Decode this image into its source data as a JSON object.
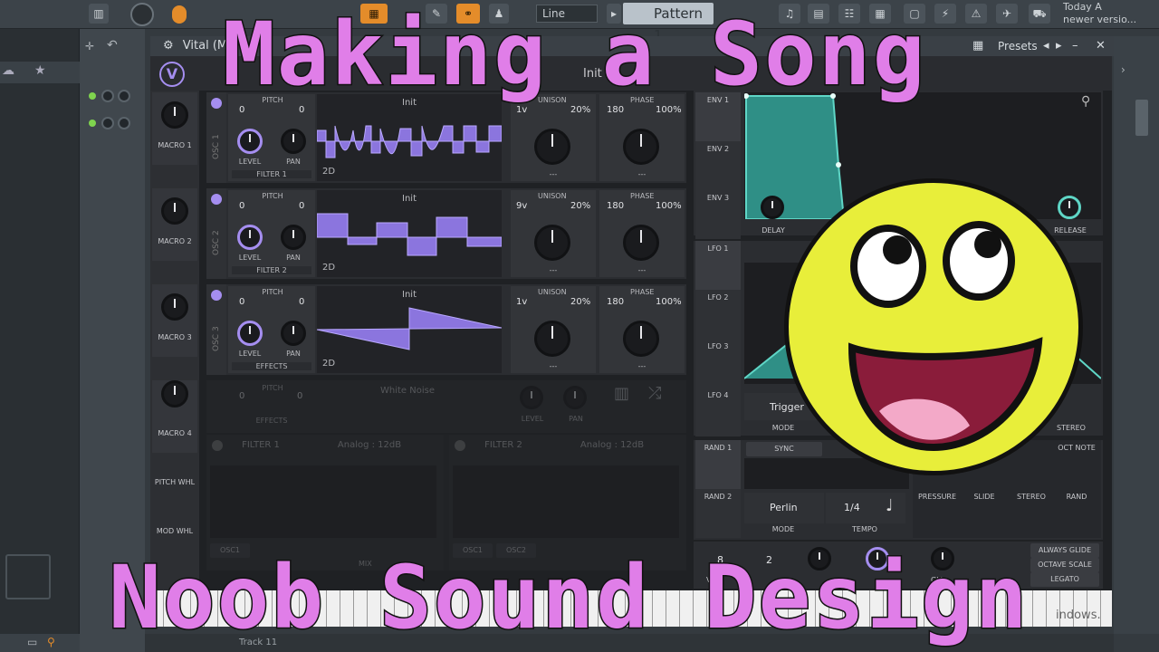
{
  "overlay": {
    "title_top": "Making a Song",
    "title_bottom": "Noob Sound Design"
  },
  "toolbar": {
    "line_select": "Line",
    "pattern_name": "Pattern 1",
    "hint_line1": "Today  A",
    "hint_line2": "newer versio..."
  },
  "vital": {
    "window_title": "Vital (M",
    "preset_name": "Init P",
    "presets_label": "Presets",
    "macros": [
      "MACRO 1",
      "MACRO 2",
      "MACRO 3",
      "MACRO 4"
    ],
    "pitch_wheel": "PITCH WHL",
    "mod_wheel": "MOD WHL",
    "oscillators": [
      {
        "name": "OSC 1",
        "wave": "Init",
        "pitch_l": "0",
        "pitch_r": "0",
        "voices": "1v",
        "unison_pct": "20%",
        "phase": "180",
        "phase_pct": "100%",
        "route": "FILTER 1"
      },
      {
        "name": "OSC 2",
        "wave": "Init",
        "pitch_l": "0",
        "pitch_r": "0",
        "voices": "9v",
        "unison_pct": "20%",
        "phase": "180",
        "phase_pct": "100%",
        "route": "FILTER 2"
      },
      {
        "name": "OSC 3",
        "wave": "Init",
        "pitch_l": "0",
        "pitch_r": "0",
        "voices": "1v",
        "unison_pct": "20%",
        "phase": "180",
        "phase_pct": "100%",
        "route": "EFFECTS"
      }
    ],
    "labels": {
      "pitch": "PITCH",
      "level": "LEVEL",
      "pan": "PAN",
      "unison": "UNISON",
      "phase": "PHASE",
      "two_d": "2D",
      "dashes": "---"
    },
    "sample": {
      "name": "White Noise",
      "pitch_l": "0",
      "pitch_r": "0",
      "route": "EFFECTS",
      "level": "LEVEL",
      "pan": "PAN"
    },
    "filters": [
      {
        "name": "FILTER 1",
        "type": "Analog : 12dB"
      },
      {
        "name": "FILTER 2",
        "type": "Analog : 12dB"
      }
    ],
    "filter_osc_chips": [
      "OSC1",
      "OSC2"
    ],
    "filter_mix": "MIX",
    "envelopes": [
      "ENV 1",
      "ENV 2",
      "ENV 3"
    ],
    "env_knobs": {
      "delay": "DELAY",
      "release": "RELEASE"
    },
    "lfos": [
      "LFO 1",
      "LFO 2",
      "LFO 3",
      "LFO 4"
    ],
    "lfo_mode_value": "Trigger",
    "lfo_mode": "MODE",
    "lfo_stereo": "STEREO",
    "rands": [
      "RAND 1",
      "RAND 2"
    ],
    "rand_sync": "SYNC",
    "rand_mode_value": "Perlin",
    "rand_mode": "MODE",
    "rand_tempo_value": "1/4",
    "rand_tempo": "TEMPO",
    "mod_sources": [
      "PRESSURE",
      "SLIDE",
      "STEREO",
      "RAND"
    ],
    "oct_note": "OCT NOTE",
    "voice_count": "8",
    "voice_label": "VO",
    "bend": "2",
    "glide_label": "GLI",
    "glide_options": [
      "ALWAYS GLIDE",
      "OCTAVE SCALE",
      "LEGATO"
    ],
    "watermark": "indows."
  },
  "status": {
    "track": "Track 11"
  },
  "colors": {
    "accent_purple": "#a58ef0",
    "title_pink": "#e07ee8",
    "env_teal": "#3aa89a",
    "smiley_yellow": "#e8ee3a",
    "fl_orange": "#e48c2a"
  }
}
